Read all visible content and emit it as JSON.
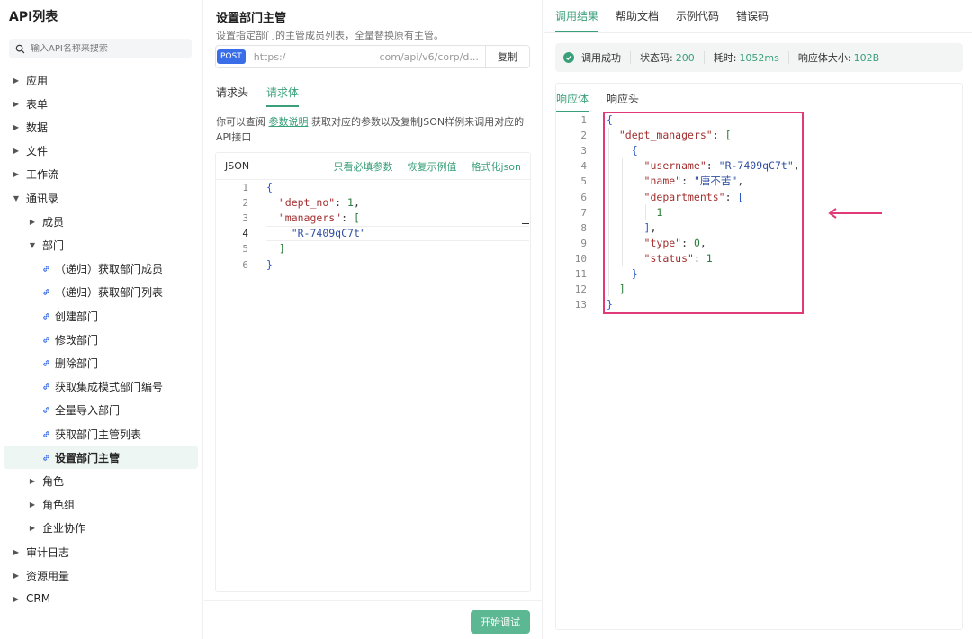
{
  "sidebar": {
    "title": "API列表",
    "search_placeholder": "输入API名称来搜索",
    "items": [
      {
        "label": "应用",
        "level": 0,
        "expanded": false
      },
      {
        "label": "表单",
        "level": 0,
        "expanded": false
      },
      {
        "label": "数据",
        "level": 0,
        "expanded": false
      },
      {
        "label": "文件",
        "level": 0,
        "expanded": false
      },
      {
        "label": "工作流",
        "level": 0,
        "expanded": false
      },
      {
        "label": "通讯录",
        "level": 0,
        "expanded": true
      },
      {
        "label": "成员",
        "level": 1,
        "expanded": false
      },
      {
        "label": "部门",
        "level": 1,
        "expanded": true
      },
      {
        "label": "（递归）获取部门成员",
        "level": 2,
        "type": "api"
      },
      {
        "label": "（递归）获取部门列表",
        "level": 2,
        "type": "api"
      },
      {
        "label": "创建部门",
        "level": 2,
        "type": "api"
      },
      {
        "label": "修改部门",
        "level": 2,
        "type": "api"
      },
      {
        "label": "删除部门",
        "level": 2,
        "type": "api"
      },
      {
        "label": "获取集成模式部门编号",
        "level": 2,
        "type": "api"
      },
      {
        "label": "全量导入部门",
        "level": 2,
        "type": "api"
      },
      {
        "label": "获取部门主管列表",
        "level": 2,
        "type": "api"
      },
      {
        "label": "设置部门主管",
        "level": 2,
        "type": "api",
        "active": true
      },
      {
        "label": "角色",
        "level": 1,
        "expanded": false
      },
      {
        "label": "角色组",
        "level": 1,
        "expanded": false
      },
      {
        "label": "企业协作",
        "level": 1,
        "expanded": false
      },
      {
        "label": "审计日志",
        "level": 0,
        "expanded": false
      },
      {
        "label": "资源用量",
        "level": 0,
        "expanded": false
      },
      {
        "label": "CRM",
        "level": 0,
        "expanded": false
      }
    ]
  },
  "middle": {
    "title": "设置部门主管",
    "desc": "设置指定部门的主管成员列表，全量替换原有主管。",
    "method": "POST",
    "url_prefix": "https:/",
    "url_suffix": "com/api/v6/corp/d...",
    "copy_label": "复制",
    "tabs": [
      {
        "label": "请求头",
        "active": false
      },
      {
        "label": "请求体",
        "active": true
      }
    ],
    "hint_before": "你可以查阅 ",
    "hint_link": "参数说明",
    "hint_after": " 获取对应的参数以及复制JSON样例来调用对应的API接口",
    "json_label": "JSON",
    "actions": [
      "只看必填参数",
      "恢复示例值",
      "格式化json"
    ],
    "start_label": "开始调试"
  },
  "right": {
    "tabs": [
      {
        "label": "调用结果",
        "active": true
      },
      {
        "label": "帮助文档",
        "active": false
      },
      {
        "label": "示例代码",
        "active": false
      },
      {
        "label": "错误码",
        "active": false
      }
    ],
    "status": {
      "success": "调用成功",
      "code_label": "状态码:",
      "code_value": "200",
      "time_label": "耗时:",
      "time_value": "1052ms",
      "size_label": "响应体大小:",
      "size_value": "102B"
    },
    "resp_tabs": [
      {
        "label": "响应体",
        "active": true
      },
      {
        "label": "响应头",
        "active": false
      }
    ]
  },
  "colors": {
    "accent": "#3aa07a",
    "highlight": "#e03a78",
    "method_badge": "#3a6ee8"
  },
  "request_code": [
    [
      {
        "t": "{",
        "c": "p"
      }
    ],
    [
      {
        "t": "  "
      },
      {
        "t": "\"dept_no\"",
        "c": "k"
      },
      {
        "t": ": "
      },
      {
        "t": "1",
        "c": "n"
      },
      {
        "t": ","
      }
    ],
    [
      {
        "t": "  "
      },
      {
        "t": "\"managers\"",
        "c": "k"
      },
      {
        "t": ": "
      },
      {
        "t": "[",
        "c": "n"
      }
    ],
    [
      {
        "t": "    "
      },
      {
        "t": "\"R-7409qC7t\"",
        "c": "s"
      }
    ],
    [
      {
        "t": "  "
      },
      {
        "t": "]",
        "c": "n"
      }
    ],
    [
      {
        "t": "}",
        "c": "p"
      }
    ]
  ],
  "response_code": [
    [
      {
        "t": "{",
        "c": "p"
      }
    ],
    [
      {
        "t": "  "
      },
      {
        "t": "\"dept_managers\"",
        "c": "k"
      },
      {
        "t": ": "
      },
      {
        "t": "[",
        "c": "n"
      }
    ],
    [
      {
        "t": "    "
      },
      {
        "t": "{",
        "c": "p"
      }
    ],
    [
      {
        "t": "      "
      },
      {
        "t": "\"username\"",
        "c": "k"
      },
      {
        "t": ": "
      },
      {
        "t": "\"R-7409qC7t\"",
        "c": "s"
      },
      {
        "t": ","
      }
    ],
    [
      {
        "t": "      "
      },
      {
        "t": "\"name\"",
        "c": "k"
      },
      {
        "t": ": "
      },
      {
        "t": "\"唐不苦\"",
        "c": "s"
      },
      {
        "t": ","
      }
    ],
    [
      {
        "t": "      "
      },
      {
        "t": "\"departments\"",
        "c": "k"
      },
      {
        "t": ": "
      },
      {
        "t": "[",
        "c": "p"
      }
    ],
    [
      {
        "t": "        "
      },
      {
        "t": "1",
        "c": "n"
      }
    ],
    [
      {
        "t": "      "
      },
      {
        "t": "]",
        "c": "p"
      },
      {
        "t": ","
      }
    ],
    [
      {
        "t": "      "
      },
      {
        "t": "\"type\"",
        "c": "k"
      },
      {
        "t": ": "
      },
      {
        "t": "0",
        "c": "n"
      },
      {
        "t": ","
      }
    ],
    [
      {
        "t": "      "
      },
      {
        "t": "\"status\"",
        "c": "k"
      },
      {
        "t": ": "
      },
      {
        "t": "1",
        "c": "n"
      }
    ],
    [
      {
        "t": "    "
      },
      {
        "t": "}",
        "c": "p"
      }
    ],
    [
      {
        "t": "  "
      },
      {
        "t": "]",
        "c": "n"
      }
    ],
    [
      {
        "t": "}",
        "c": "p"
      }
    ]
  ]
}
